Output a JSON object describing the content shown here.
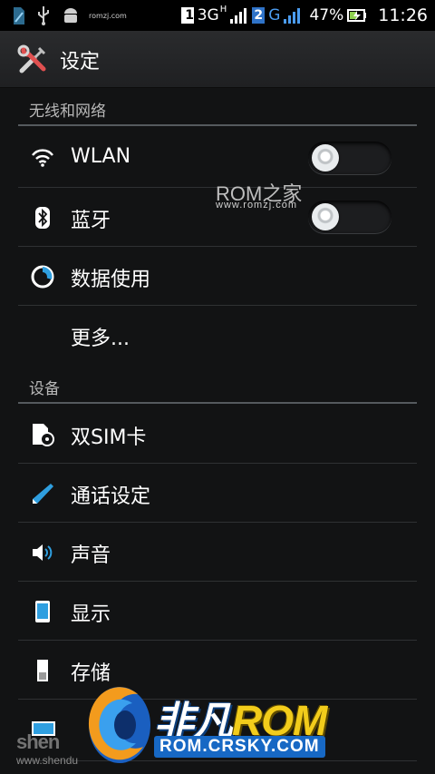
{
  "status_bar": {
    "mini_site": "romzj.com",
    "sim1_number": "1",
    "sim1_network": "3G",
    "sim1_network_mode": "H",
    "sim2_number": "2",
    "sim2_network": "G",
    "battery": "47%",
    "time": "11:26"
  },
  "action_bar": {
    "title": "设定",
    "icon": "settings-tools-icon"
  },
  "sections": {
    "wireless": {
      "header": "无线和网络"
    },
    "device": {
      "header": "设备"
    }
  },
  "items": {
    "wlan": {
      "label": "WLAN",
      "icon": "wifi-icon",
      "toggle_on": false
    },
    "bluetooth": {
      "label": "蓝牙",
      "icon": "bluetooth-icon",
      "toggle_on": false
    },
    "data_usage": {
      "label": "数据使用",
      "icon": "data-usage-icon"
    },
    "more": {
      "label": "更多..."
    },
    "dual_sim": {
      "label": "双SIM卡",
      "icon": "sim-card-icon"
    },
    "call_settings": {
      "label": "通话设定",
      "icon": "phone-handset-icon"
    },
    "sound": {
      "label": "声音",
      "icon": "speaker-icon"
    },
    "display": {
      "label": "显示",
      "icon": "display-icon"
    },
    "storage": {
      "label": "存储",
      "icon": "storage-icon"
    }
  },
  "watermarks": {
    "romzj_logo": "ROM之家",
    "romzj_url": "www.romzj.com",
    "feifan_name": "非凡",
    "feifan_rom": "ROM",
    "feifan_url": "ROM.CRSKY.COM",
    "shendu_name": "shen",
    "shendu_url": "www.shendu"
  },
  "colors": {
    "background": "#121314",
    "section_header": "#b8b8b8",
    "accent_blue": "#2f9fe0",
    "brand_yellow": "#f2cc1b"
  }
}
